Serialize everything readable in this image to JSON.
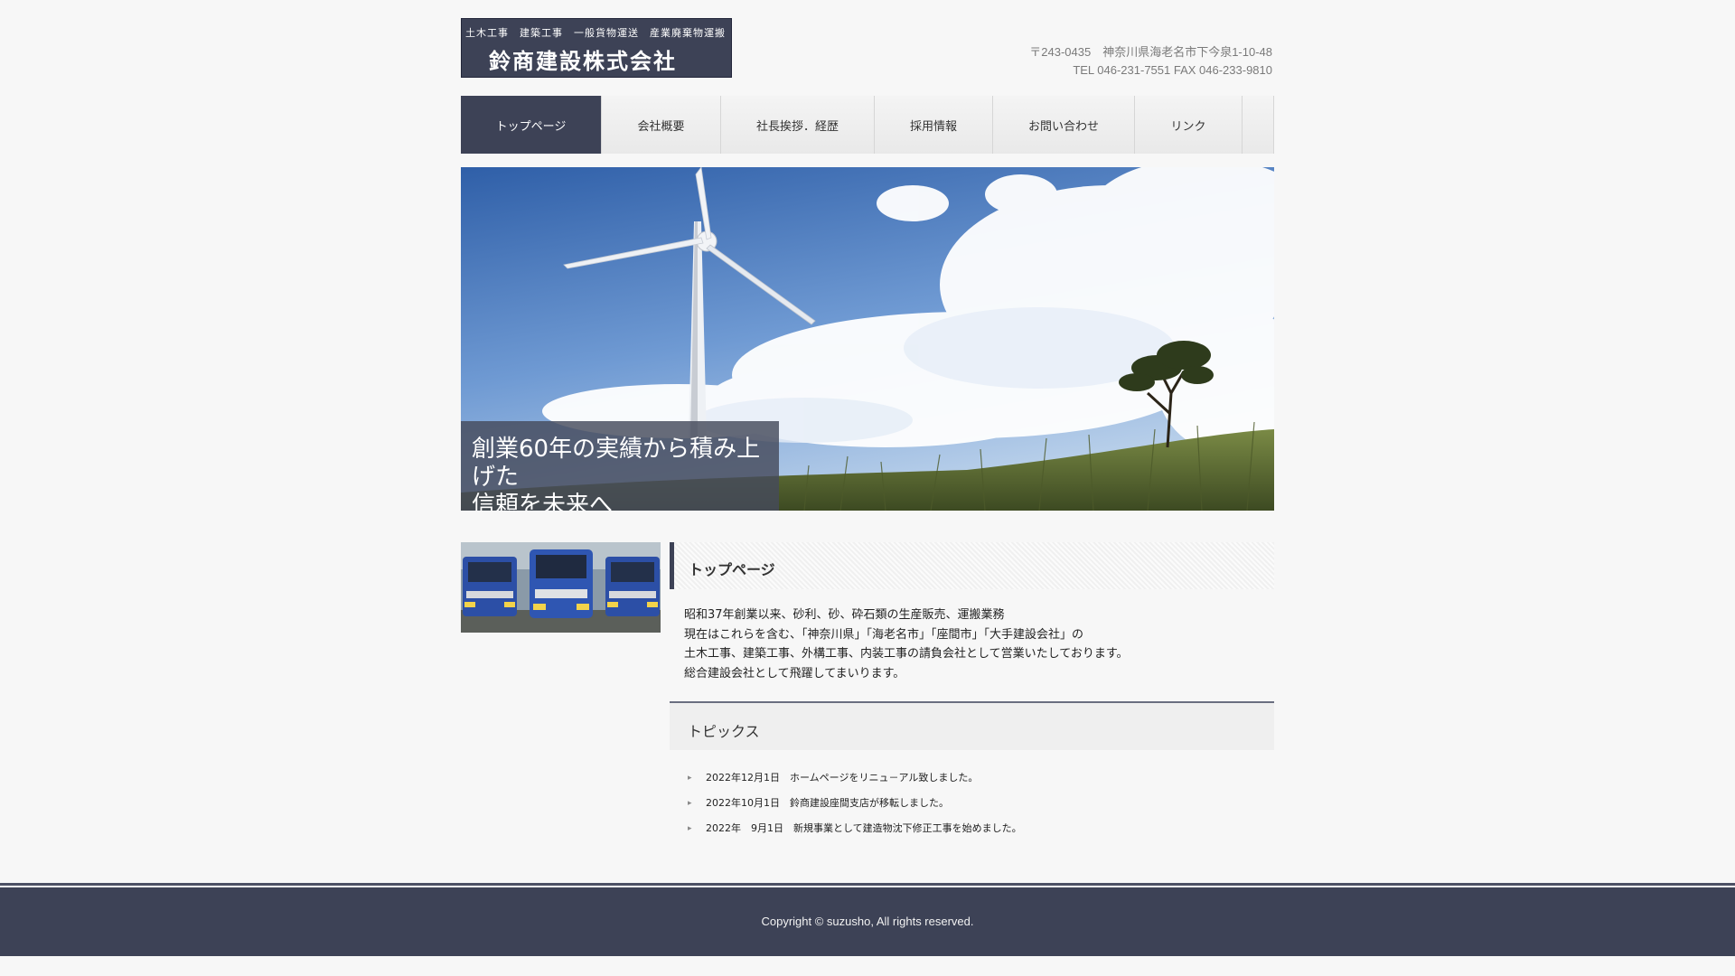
{
  "header": {
    "logo_sub": "土木工事　建築工事　一般貨物運送　産業廃棄物運搬",
    "logo_main": "鈴商建設株式会社",
    "address": "〒243-0435　神奈川県海老名市下今泉1-10-48",
    "phone": "TEL 046-231-7551 FAX 046-233-9810"
  },
  "nav": {
    "items": [
      {
        "label": "トップページ"
      },
      {
        "label": "会社概要"
      },
      {
        "label": "社長挨拶．経歴"
      },
      {
        "label": "採用情報"
      },
      {
        "label": "お問い合わせ"
      },
      {
        "label": "リンク"
      }
    ]
  },
  "hero": {
    "caption_line1": "創業60年の実績から積み上げた",
    "caption_line2": "信頼を未来へ"
  },
  "main": {
    "page_heading": "トップページ",
    "intro": [
      "昭和37年創業以来、砂利、砂、砕石類の生産販売、運搬業務",
      "現在はこれらを含む、「神奈川県」「海老名市」｢座間市」「大手建設会社」の",
      "土木工事、建築工事、外構工事、内装工事の請負会社として営業いたしております。",
      "総合建設会社として飛躍してまいります。"
    ],
    "topics_heading": "トピックス",
    "topics": [
      "2022年12月1日　ホームページをリニュ－アル致しました。",
      "2022年10月1日　鈴商建設座間支店が移転しました。",
      "2022年　9月1日　新規事業として建造物沈下修正工事を始めました。"
    ]
  },
  "footer": {
    "copyright": "Copyright © suzusho, All rights reserved."
  }
}
